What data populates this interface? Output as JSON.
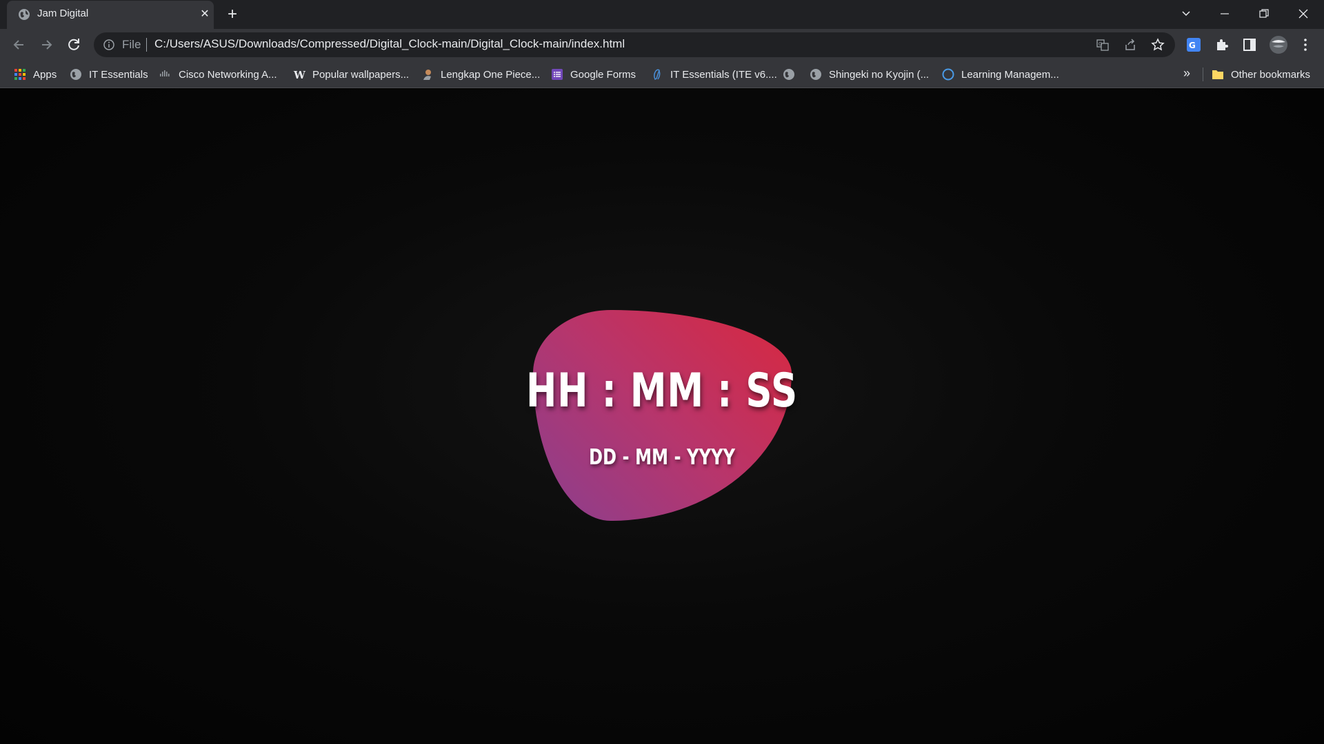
{
  "browser": {
    "tab": {
      "title": "Jam Digital",
      "close": "✕",
      "favicon": "globe-icon"
    },
    "new_tab": "+",
    "window_controls": {
      "tab_search": "⌵",
      "minimize": "—",
      "restore": "❐",
      "close": "✕"
    },
    "omnibox": {
      "scheme_label": "File",
      "url": "C:/Users/ASUS/Downloads/Compressed/Digital_Clock-main/Digital_Clock-main/index.html"
    },
    "bookmarks": [
      {
        "label": "Apps",
        "icon": "apps-grid-icon"
      },
      {
        "label": "IT Essentials",
        "icon": "globe-icon"
      },
      {
        "label": "Cisco Networking A...",
        "icon": "cisco-icon"
      },
      {
        "label": "Popular wallpapers...",
        "icon": "w-logo-icon"
      },
      {
        "label": "Lengkap One Piece...",
        "icon": "character-icon"
      },
      {
        "label": "Google Forms",
        "icon": "forms-icon"
      },
      {
        "label": "IT Essentials (ITE v6....",
        "icon": "link-icon"
      },
      {
        "label": "",
        "icon": "globe-icon"
      },
      {
        "label": "Shingeki no Kyojin (...",
        "icon": "globe-icon"
      },
      {
        "label": "Learning Managem...",
        "icon": "circle-icon"
      }
    ],
    "more_bookmarks": "»",
    "other_bookmarks": "Other bookmarks"
  },
  "page": {
    "clock_time": "HH : MM : SS",
    "clock_date": "DD - MM - YYYY"
  },
  "colors": {
    "blob_start": "#8a3f8f",
    "blob_end": "#d8283f",
    "chrome_dark": "#202124",
    "chrome_toolbar": "#35363a"
  }
}
